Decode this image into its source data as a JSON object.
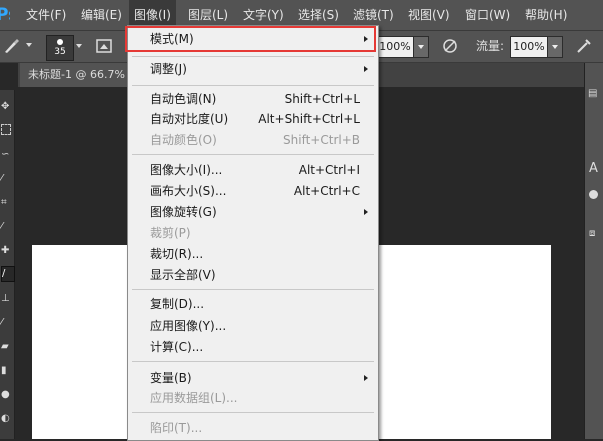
{
  "menubar": {
    "logo": "Ps",
    "items": [
      {
        "label": "文件(F)"
      },
      {
        "label": "编辑(E)"
      },
      {
        "label": "图像(I)"
      },
      {
        "label": "图层(L)"
      },
      {
        "label": "文字(Y)"
      },
      {
        "label": "选择(S)"
      },
      {
        "label": "滤镜(T)"
      },
      {
        "label": "视图(V)"
      },
      {
        "label": "窗口(W)"
      },
      {
        "label": "帮助(H)"
      }
    ],
    "active_index": 2
  },
  "options_bar": {
    "brush_size": "35",
    "opacity_value": "100%",
    "flow_label": "流量:",
    "flow_value": "100%"
  },
  "document": {
    "tab_title": "未标题-1 @ 66.7%"
  },
  "image_menu": {
    "items": [
      {
        "label": "模式(M)",
        "shortcut": "",
        "submenu": true,
        "disabled": false,
        "highlighted": true
      },
      {
        "label": "调整(J)",
        "shortcut": "",
        "submenu": true,
        "disabled": false
      },
      {
        "label": "自动色调(N)",
        "shortcut": "Shift+Ctrl+L",
        "submenu": false,
        "disabled": false
      },
      {
        "label": "自动对比度(U)",
        "shortcut": "Alt+Shift+Ctrl+L",
        "submenu": false,
        "disabled": false
      },
      {
        "label": "自动颜色(O)",
        "shortcut": "Shift+Ctrl+B",
        "submenu": false,
        "disabled": true
      },
      {
        "label": "图像大小(I)...",
        "shortcut": "Alt+Ctrl+I",
        "submenu": false,
        "disabled": false
      },
      {
        "label": "画布大小(S)...",
        "shortcut": "Alt+Ctrl+C",
        "submenu": false,
        "disabled": false
      },
      {
        "label": "图像旋转(G)",
        "shortcut": "",
        "submenu": true,
        "disabled": false
      },
      {
        "label": "裁剪(P)",
        "shortcut": "",
        "submenu": false,
        "disabled": true
      },
      {
        "label": "裁切(R)...",
        "shortcut": "",
        "submenu": false,
        "disabled": false
      },
      {
        "label": "显示全部(V)",
        "shortcut": "",
        "submenu": false,
        "disabled": false
      },
      {
        "label": "复制(D)...",
        "shortcut": "",
        "submenu": false,
        "disabled": false
      },
      {
        "label": "应用图像(Y)...",
        "shortcut": "",
        "submenu": false,
        "disabled": false
      },
      {
        "label": "计算(C)...",
        "shortcut": "",
        "submenu": false,
        "disabled": false
      },
      {
        "label": "变量(B)",
        "shortcut": "",
        "submenu": true,
        "disabled": false
      },
      {
        "label": "应用数据组(L)...",
        "shortcut": "",
        "submenu": false,
        "disabled": true
      },
      {
        "label": "陷印(T)...",
        "shortcut": "",
        "submenu": false,
        "disabled": true
      }
    ]
  },
  "colors": {
    "highlight_border": "#e53935",
    "menubar_bg": "#535353",
    "menu_bg": "#f0f0f0",
    "disabled_text": "#9a9a9a"
  }
}
